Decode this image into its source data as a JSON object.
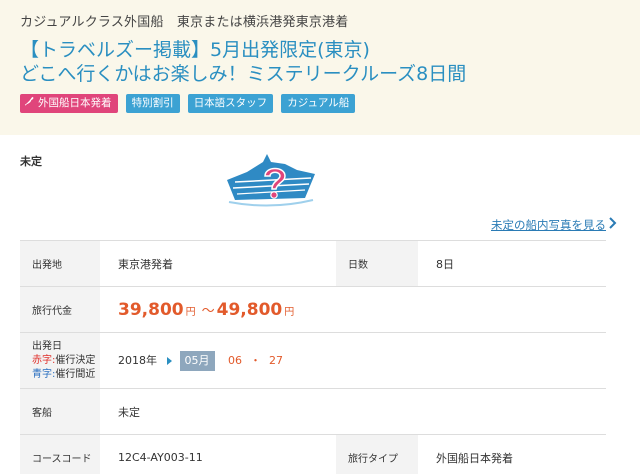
{
  "header": {
    "subtitle": "カジュアルクラス外国船　東京または横浜港発東京港着",
    "title_line1": "【トラベルズー掲載】5月出発限定(東京)",
    "title_line2": "どこへ行くかはお楽しみ！ミステリークルーズ8日間",
    "tags": [
      {
        "label": "外国船日本発着",
        "color": "#e0457b",
        "icon": "japan-map-icon"
      },
      {
        "label": "特別割引",
        "color": "#3ca2d3"
      },
      {
        "label": "日本語スタッフ",
        "color": "#3ca2d3"
      },
      {
        "label": "カジュアル船",
        "color": "#3ca2d3"
      }
    ]
  },
  "ship": {
    "label": "未定",
    "image_icon": "mystery-ship-icon",
    "photo_link": "未定の船内写真を見る"
  },
  "details": {
    "departure_label": "出発地",
    "departure_value": "東京港発着",
    "days_label": "日数",
    "days_value": "8日",
    "price_label": "旅行代金",
    "price_min": "39,800",
    "price_max": "49,800",
    "yen": "円",
    "tilde": "～",
    "date_label": "出発日",
    "red_note": "赤字:",
    "red_note_text": "催行決定",
    "blue_note": "青字:",
    "blue_note_text": "催行間近",
    "year": "2018年",
    "month": "05月",
    "day1": "06",
    "date_sep": "・",
    "day2": "27",
    "ship_label": "客船",
    "ship_value": "未定",
    "course_label": "コースコード",
    "course_value": "12C4-AY003-11",
    "type_label": "旅行タイプ",
    "type_value": "外国船日本発着"
  }
}
